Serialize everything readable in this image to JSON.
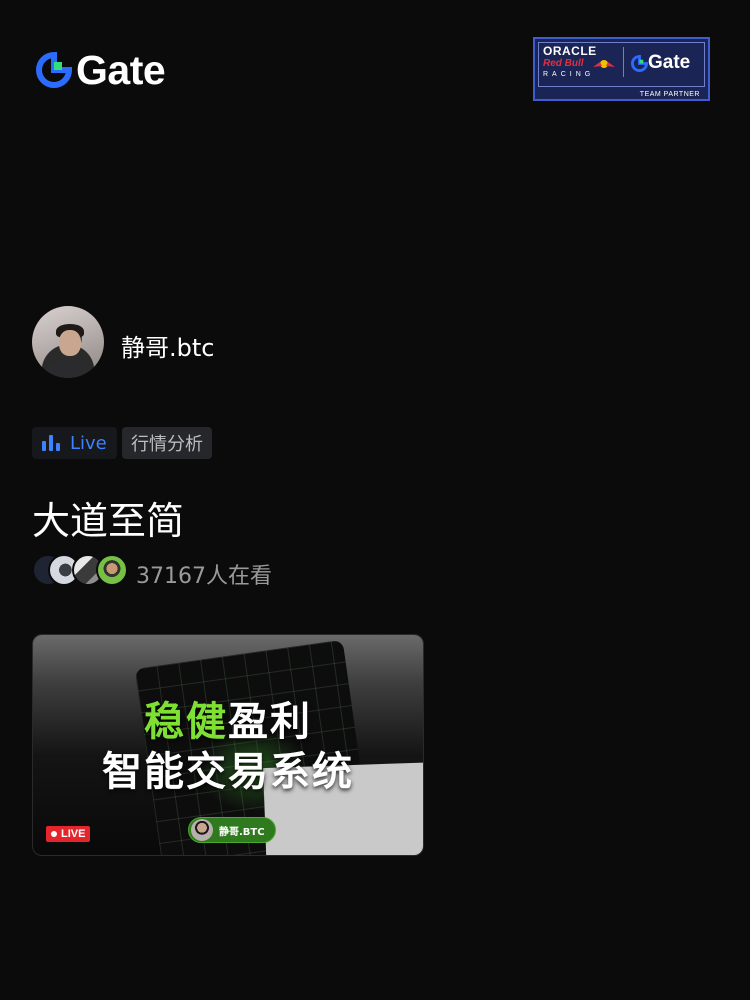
{
  "header": {
    "brand": "Gate",
    "partner": {
      "line1": "ORACLE",
      "line2": "Red Bull",
      "line3": "RACING",
      "brand": "Gate",
      "footer": "TEAM PARTNER"
    }
  },
  "host": {
    "name": "静哥.btc"
  },
  "tags": {
    "live": "Live",
    "category": "行情分析"
  },
  "stream": {
    "title": "大道至简",
    "viewers": "37167人在看"
  },
  "card": {
    "headline_highlight": "稳健",
    "headline_rest": "盈利",
    "headline2": "智能交易系统",
    "live_badge": "LIVE",
    "host_chip": "静哥.BTC"
  },
  "colors": {
    "background": "#0b0b0c",
    "accent_blue": "#3d82ff",
    "highlight_green": "#7ee032",
    "live_red": "#e3262c"
  },
  "icons": [
    "gate-logo-icon",
    "bar-chart-icon",
    "red-bull-icon",
    "live-dot-icon"
  ]
}
